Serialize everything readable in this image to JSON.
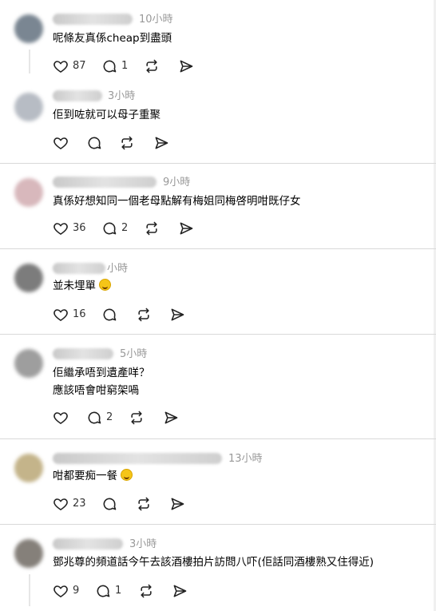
{
  "comments": [
    {
      "time": "10小時",
      "lines": [
        "呢條友真係cheap到盡頭"
      ],
      "likes": "87",
      "replies": "1",
      "avatar": "#7a8692"
    },
    {
      "time": "3小時",
      "lines": [
        "佢到咗就可以母子重聚"
      ],
      "likes": "",
      "replies": "",
      "avatar": "#b7bcc4"
    },
    {
      "time": "9小時",
      "lines": [
        "真係好想知同一個老母點解有梅姐同梅啓明咁既仔女"
      ],
      "likes": "36",
      "replies": "2",
      "avatar": "#d8b8bc"
    },
    {
      "time": "小時",
      "lines": [
        "並未埋單"
      ],
      "likes": "16",
      "replies": "",
      "avatar": "#7c7c7c",
      "emoji": true
    },
    {
      "time": "5小時",
      "lines": [
        "佢繼承唔到遺產咩？",
        "應該唔會咁窮架喎"
      ],
      "likes": "",
      "replies": "2",
      "avatar": "#9e9e9e"
    },
    {
      "time": "13小時",
      "lines": [
        "咁都要痴一餐"
      ],
      "likes": "23",
      "replies": "",
      "avatar": "#c4b48a",
      "emoji": true
    },
    {
      "time": "3小時",
      "lines": [
        "鄧兆尊的頻道話今午去該酒樓拍片訪問八吓(佢話同酒樓熟又住得近)"
      ],
      "likes": "9",
      "replies": "1",
      "avatar": "#85807a"
    }
  ],
  "icons": {
    "like": "heart-icon",
    "reply": "comment-icon",
    "repost": "repost-icon",
    "share": "send-icon"
  }
}
